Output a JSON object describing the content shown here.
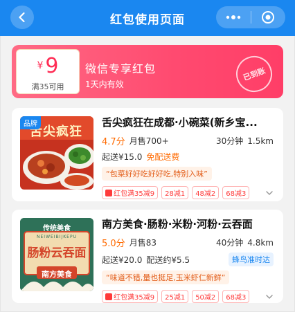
{
  "header": {
    "title": "红包使用页面",
    "back_icon": "chevron-left-icon",
    "more_icon": "more-dots-icon",
    "target_icon": "target-icon",
    "bg_color": "#1a87f0"
  },
  "coupon": {
    "currency": "¥",
    "amount": "9",
    "condition": "满35可用",
    "title": "微信专享红包",
    "subtitle": "1天内有效",
    "stamp": "已到账"
  },
  "stores": [
    {
      "brand_tag": "品牌",
      "name": "舌尖疯狂在成都·小碗菜(新乡宝...",
      "rating": "4.7分",
      "monthly_sales": "月售700+",
      "time": "30分钟",
      "distance": "1.5km",
      "min_order": "起送¥15.0",
      "delivery": "免配送费",
      "review": "“包菜好好吃好好吃,特别入味”",
      "promos": [
        "红包满35减9",
        "28减1",
        "48减2",
        "68减3"
      ],
      "thumb_text": "舌尖疯狂"
    },
    {
      "name": "南方美食·肠粉·米粉·河粉·云吞面",
      "rating": "5.0分",
      "monthly_sales": "月售83",
      "time": "40分钟",
      "distance": "4.8km",
      "min_order": "起送¥20.0",
      "delivery": "配送约¥5.5",
      "delivery_badge": "蜂鸟准时达",
      "review": "“味道不错,量也挺足,玉米虾仁新鲜”",
      "promos": [
        "红包满35减9",
        "25减1",
        "50减2",
        "68减3"
      ],
      "thumb_top": "传统美食",
      "thumb_pinyin": "NEIWEIBIJKEPU",
      "thumb_main": "肠粉云吞面",
      "thumb_sub": "南方美食"
    }
  ]
}
